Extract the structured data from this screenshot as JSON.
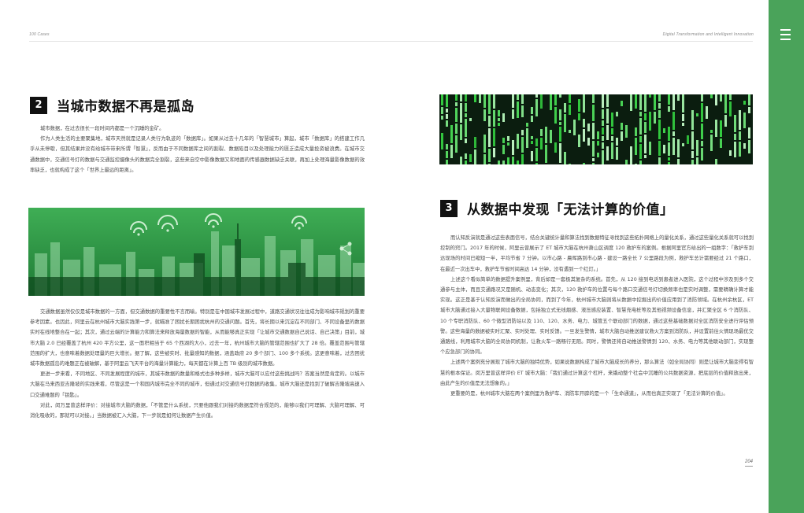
{
  "header": {
    "left": "100 Cases",
    "right": "Digital Transformation and Intelligent Innovation"
  },
  "section2": {
    "number": "2",
    "title": "当城市数据不再是孤岛",
    "paragraphs_top": [
      "城市数据，在过去很长一段时间内都是一个沉睡的金矿。",
      "作为人类生活的主要聚集地，城市天然就是记录人类行为轨迹的「数据库」。如果从过去十几年的「智慧城市」算起，城市「数据库」的搭建工作几乎从未停歇，但其结果并没有给城市带来所谓「智慧」，反而由于不同数据库之间的割裂、数据陷目以及处理能力的匮乏造成大量投资被浪费。在城市交通数据中，交通信号灯的数据与交通监控摄像头的数据完全割裂，这些来自空中影像数据又和地面的传感器数据缺乏关联，再加上处理海量影像数据的效率缺乏，也就构成了这个「世界上最远的距离」。"
    ],
    "paragraphs_bottom": [
      "交通数据虽然仅仅是城市数据的一方面，但交通数据的重要性不言而喻。特别是在中国城市发展过程中，道路交通状况往往成为影响城市规划的重要参考因素。也因此，阿里云在杭州城市大脑实践第一步，就瞄准了困扰长期困扰杭州的交通问题。首先，将长期以来沉淀在不同部门、不同设备里的数据实时在线地整合在一起；其次，通过云端的计算能力和算法来释放海量数据的智能，从而能够真正实现「让城市交通数据自己说话、自己决策」目前，城市大脑 2.0 已经覆盖了杭州 420 平方公里，这一面积相当于 65 个西湖的大小，过去一年，杭州城市大脑的管辖范围也扩大了 28 倍。覆盖范围与管辖范围的扩大，也意味着数据处理量的巨大增长。据了解，这些被实时、批量感知的数据，涵盖政府 20 多个部门、100 多个系统。这更意味着，过去困扰城市数据孤岛的难题正在被破解，基于阿里云飞天平台的海量计算能力，每天都在计算上百 TB 级别的城市数据。",
      "更进一步来看，不同地区、不同发展程度的城市，其城市数据的数量和格式也多种多样，城市大脑可以应付这些挑战吗？答案当然是肯定的。以城市大脑在马来西亚吉隆坡的实践来看，尽管这是一个和国内城市完全不同的城市，但通过对交通信号灯数据的收集，城市大脑还是找到了破解吉隆坡高速入口交通难题的「钥匙」。",
      "对此，闵万里曾这样评价：对接城市大脑的数据，「不管是什么系统，只要他跟我们对接的数据是符合规范的，能够以我们可理解、大脑可理解、可消化吸收的，那就可以对接。」当数据被汇入大脑，下一步就是如何让数据产生价值。"
    ]
  },
  "section3": {
    "number": "3",
    "title": "从数据中发现「无法计算的价值」",
    "paragraphs": [
      "而认知反演就是通过这些表面信号，结合关键统计量和算法找到数据特征寻找到这些拓扑网络上的量化关系，通过这些量化关系就可以找到控制的窍门。2017 年的时候，阿里云曾展示了 ET 城市大脑在杭州萧山区调度 120 救护车的案例。根据阿里官方给出的一组数字：「救护车到达现场的时间已缩短一半，平均节省 7 分钟。以市心路 - 晨晖路到市心路 - 建设一路全长 7 公里路段为例，救护车总计需要经过 21 个路口，在最近一次出车中，救护车节省时间高达 14 分钟，没有遇到一个红灯。」",
      "上述这个看似简单的数据提升案例里，背后却是一套极其复杂的系统。首先，从 120 接到电话到患者进入医院，这个过程中涉及到多个交通参与主体，而且交通路况又是随机、动态变化；其次，120 救护车的位置与每个路口交通信号灯切换频率也是实时调整，需要精确计算才能实现。这正是基于认知反演而做出的全局协同，而到了今年，杭州城市大脑则将从数据中挖掘出的价值应用到了消防领域。在杭州余杭区，ET 城市大脑通过接入大量物联网设备数据，包括独立式无线烟感、液压感应装置、智慧充电桩等及其他视频设备信息，并汇聚全区 6 个消防队、10 个专职消防队、60 个微型消防站以及 110、120、水务、电力、城管五个联动部门的数据，通过这些基础数据对全区消防安全进行评估预警。这些海量的数据被实时汇聚、实时处理、实时反馈。一旦发生警情，城市大脑自动推送建议救火方案到消防队，并设置前往火情现场最优交通路线，利用城市大脑的全局协同机制，让救火车一路畅行无阻。同时，警情还将自动推送警情到 120、水务、电力等其他联动部门，实现整个应急部门的协同。",
      "上述两个案例充分展现了城市大脑的独特优势，如果说数据构成了城市大脑成长的养分，那么算法（如全局协同）则是让城市大脑变得有智慧的根本保证。闵万里曾这样评价 ET 城市大脑：「我们通过计算这个杠杆，来撬动整个社会中沉睡的公共数据资源，把底层的价值释放出来，由此产生的价值是无法想象的。」",
      "更重要的是，杭州城市大脑在两个案例里为救护车、消防车开辟的是一个「生命通道」，从而也真正实现了「无法计算的价值」。"
    ]
  },
  "page_number": "204",
  "colors": {
    "accent_green": "#4aa35a",
    "title_box": "#111111"
  }
}
